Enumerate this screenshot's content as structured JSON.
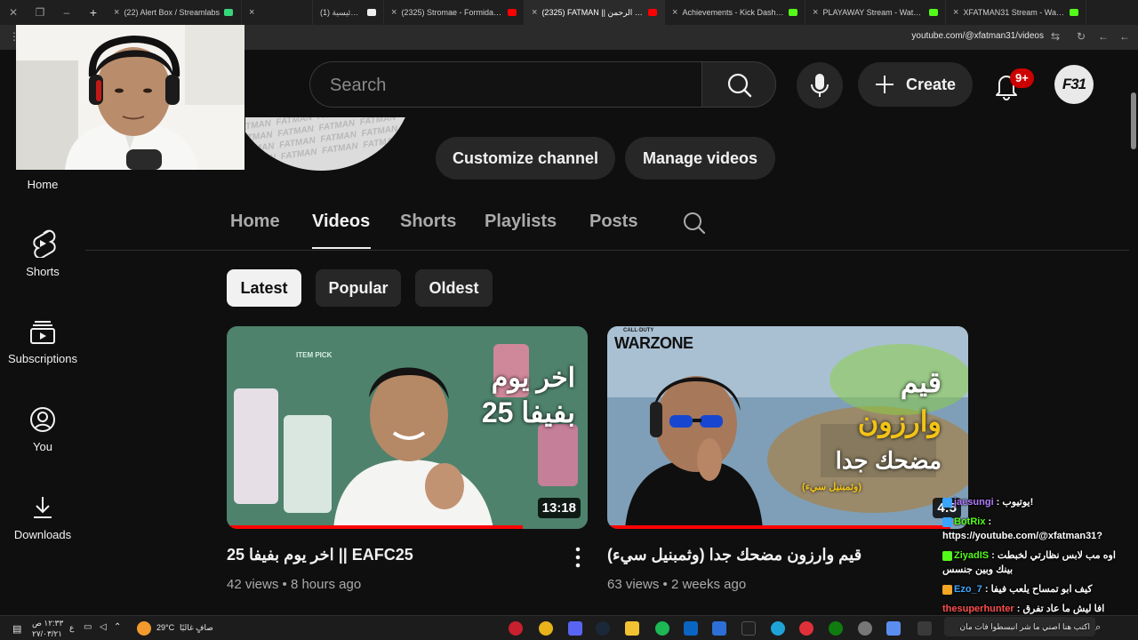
{
  "browser": {
    "tabs": [
      {
        "label": "(22) Alert Box / Streamlabs",
        "color": "#37d67a"
      },
      {
        "label": "(1) الرئيسية / X",
        "color": "#000000"
      },
      {
        "label": "(2325) Stromae - Formidable (",
        "color": "#ff0000"
      },
      {
        "label": "(2325) FATMAN || عبد الرحمن",
        "color": "#ff0000",
        "active": true
      },
      {
        "label": "Achievements - Kick Dashboard",
        "color": "#53fc18"
      },
      {
        "label": "PLAYAWAY Stream - Watch Live",
        "color": "#53fc18"
      },
      {
        "label": "XFATMAN31 Stream - Watch Li",
        "color": "#53fc18"
      }
    ],
    "url": "youtube.com/@xfatman31/videos"
  },
  "header": {
    "search_placeholder": "Search",
    "create_label": "Create",
    "notif_count": "9+",
    "avatar_text": "F31"
  },
  "banner": {
    "pattern_text": "FATMAN FATMAN FATMAN FATMAN FATMAN FATMAN FATMAN FATMAN FATMAN FATMAN FATMAN FATMAN FATMAN FATMAN FATMAN FATMAN"
  },
  "channel_actions": {
    "customize": "Customize channel",
    "manage": "Manage videos"
  },
  "tabs": [
    "Home",
    "Videos",
    "Shorts",
    "Playlists",
    "Posts"
  ],
  "active_tab": "Videos",
  "chips": [
    "Latest",
    "Popular",
    "Oldest"
  ],
  "sidebar": [
    "Home",
    "Shorts",
    "Subscriptions",
    "You",
    "Downloads"
  ],
  "videos": [
    {
      "title": "اخر يوم بفيفا 25 || EAFC25",
      "views": "42 views",
      "age": "8 hours ago",
      "duration": "13:18",
      "thumb_text": [
        "اخر يوم",
        "بفيفا 25"
      ],
      "thumb_tag": "ITEM PICK",
      "watched_fraction": 0.82
    },
    {
      "title": "قيم وارزون مضحك جدا (وثمبنيل سيء)",
      "views": "63 views",
      "age": "2 weeks ago",
      "duration": "4:5",
      "thumb_text": [
        "قيم",
        "وارزون",
        "مضحك جدا",
        "(وثمبنيل سيء)"
      ],
      "thumb_brand": "WARZONE",
      "thumb_brand_top": "CALL·DUTY",
      "watched_fraction": 0.95
    }
  ],
  "chat": [
    {
      "user": "jaesungi",
      "msg": "يوتيوب!",
      "color": "#b07cff"
    },
    {
      "user": "BotRix",
      "msg": "https://youtube.com/@xfatman31?",
      "color": "#53fc18"
    },
    {
      "user": "ZiyadIS",
      "msg": "اوه مب لابس نظارتي لخبطت بينك وبين جنسس",
      "color": "#53fc18"
    },
    {
      "user": "Ezo_7",
      "msg": "كيف ابو تمساح يلعب فيفا",
      "color": "#3ea6ff"
    },
    {
      "user": "thesuperhunter",
      "msg": "افا ليش ما عاد تفرق سلامات",
      "color": "#ff4e4e"
    }
  ],
  "chat_input": "اكتب هنا اصني ما شر انبسطوا فات مان",
  "taskbar": {
    "time": "١٢:٣٣ ص",
    "date": "٢٧/٠٣/٢١",
    "lang": "ع",
    "weather_temp": "29°C",
    "weather_desc": "صافٍ غالبًا"
  }
}
